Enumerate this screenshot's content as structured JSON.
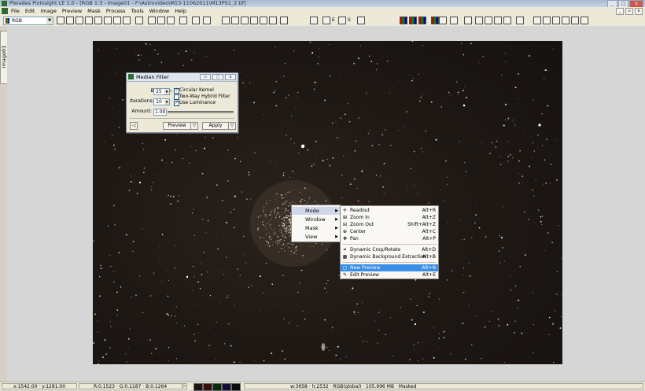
{
  "window": {
    "title": "Pleiades PixInsight LE 1.0 - [RGB 1:3 - Image01 - F:\\Astrovideo\\M13-11062011\\M13PS1_2.tif]",
    "controls": [
      "_",
      "□",
      "x"
    ]
  },
  "menubar": {
    "items": [
      "File",
      "Edit",
      "Image",
      "Preview",
      "Mask",
      "Process",
      "Tools",
      "Window",
      "Help"
    ]
  },
  "toolbar": {
    "channel_select": "RGB",
    "toggle_e_label": "E",
    "toggle_s_label": "S"
  },
  "sidebar": {
    "image_tab_label": "Image01"
  },
  "median_filter": {
    "title": "Median Filter",
    "box_size_label": "Box Size:",
    "box_size_value": "25",
    "iterations_label": "Iterations:",
    "iterations_value": "10",
    "circular_kernel_label": "Circular Kernel",
    "circular_kernel_checked": true,
    "two_way_label": "Two-Way Hybrid Filter",
    "two_way_checked": false,
    "use_luminance_label": "Use Luminance",
    "use_luminance_checked": true,
    "amount_label": "Amount:",
    "amount_value": "1.00",
    "preview_button": "Preview",
    "apply_button": "Apply"
  },
  "context_menu": {
    "items": [
      {
        "label": "Mode",
        "submenu": true,
        "highlighted": true
      },
      {
        "label": "Window",
        "submenu": true
      },
      {
        "label": "Mask",
        "submenu": true
      },
      {
        "label": "View",
        "submenu": true
      }
    ]
  },
  "mode_submenu": {
    "items": [
      {
        "label": "Readout",
        "shortcut": "Alt+R",
        "icon": "readout-icon"
      },
      {
        "label": "Zoom In",
        "shortcut": "Alt+Z",
        "icon": "zoom-in-icon"
      },
      {
        "label": "Zoom Out",
        "shortcut": "Shift+Alt+Z",
        "icon": "zoom-out-icon"
      },
      {
        "label": "Center",
        "shortcut": "Alt+C",
        "icon": "center-icon"
      },
      {
        "label": "Pan",
        "shortcut": "Alt+P",
        "icon": "pan-icon"
      },
      {
        "label": "Dynamic Crop/Rotate",
        "shortcut": "Alt+D",
        "icon": "crop-icon"
      },
      {
        "label": "Dynamic Background Extraction",
        "shortcut": "Alt+B",
        "icon": "background-icon"
      },
      {
        "label": "New Preview",
        "shortcut": "Alt+N",
        "icon": "new-preview-icon",
        "selected": true
      },
      {
        "label": "Edit Preview",
        "shortcut": "Alt+E",
        "icon": "edit-preview-icon"
      }
    ]
  },
  "statusbar": {
    "coords": "x:1542.00 · y:1281.00",
    "rgb_readout": "R:0.1523 · G:0.1187 · B:0.1264",
    "image_info": "w:3658 · h:2532 · RGB(global) · 105.996 MB · Masked"
  },
  "colors": {
    "selection": "#3a8ee6",
    "sky": "#1f1915"
  }
}
